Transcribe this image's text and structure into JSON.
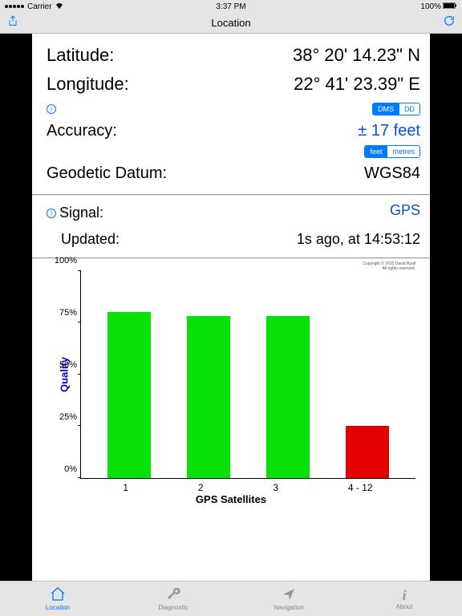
{
  "statusbar": {
    "carrier": "Carrier",
    "time": "3:37 PM",
    "battery": "100%"
  },
  "navbar": {
    "title": "Location"
  },
  "coords": {
    "lat_label": "Latitude:",
    "lat_value": "38° 20' 14.23\" N",
    "lon_label": "Longitude:",
    "lon_value": "22° 41' 23.39\" E"
  },
  "format_seg": {
    "opt1": "DMS",
    "opt2": "DD"
  },
  "accuracy": {
    "label": "Accuracy:",
    "value": "± 17 feet"
  },
  "unit_seg": {
    "opt1": "feet",
    "opt2": "metres"
  },
  "datum": {
    "label": "Geodetic Datum:",
    "value": "WGS84"
  },
  "signal": {
    "label": "Signal:",
    "value": "GPS"
  },
  "updated": {
    "label": "Updated:",
    "value": "1s ago, at 14:53:12"
  },
  "copyright": {
    "line1": "Copyright © 2015 David Ryall",
    "line2": "All rights reserved."
  },
  "chart_data": {
    "type": "bar",
    "categories": [
      "1",
      "2",
      "3",
      "4 - 12"
    ],
    "values": [
      80,
      78,
      78,
      25
    ],
    "colors": [
      "green",
      "green",
      "green",
      "red"
    ],
    "title": "",
    "xlabel": "GPS Satellites",
    "ylabel": "Quality",
    "ylim": [
      0,
      100
    ],
    "yticks": [
      "0%",
      "25%",
      "50%",
      "75%",
      "100%"
    ]
  },
  "tabs": {
    "t1": "Location",
    "t2": "Diagnostic",
    "t3": "Navigation",
    "t4": "About"
  }
}
